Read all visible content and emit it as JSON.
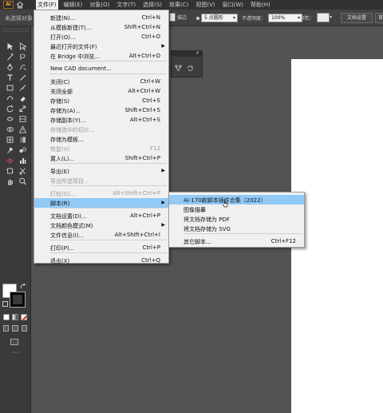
{
  "app": {
    "logo_text": "Ai"
  },
  "menubar": {
    "items": [
      "文件(F)",
      "编辑(E)",
      "对象(O)",
      "文字(T)",
      "选择(S)",
      "效果(C)",
      "视图(V)",
      "窗口(W)",
      "帮助(H)"
    ]
  },
  "controlbar": {
    "selection_status": "未选择对象",
    "style_label": "描边",
    "brush_value": "5 点圆形",
    "opacity_label": "不透明度：",
    "opacity_value": "100%",
    "opacity_arrow": ">",
    "styles_label": "样式：",
    "doc_setup_button": "文档设置",
    "prefs_button": "首"
  },
  "file_menu": {
    "items": [
      {
        "label": "新建(N)...",
        "shortcut": "Ctrl+N"
      },
      {
        "label": "从模板新建(T)...",
        "shortcut": "Shift+Ctrl+N"
      },
      {
        "label": "打开(O)...",
        "shortcut": "Ctrl+O"
      },
      {
        "label": "最近打开的文件(F)",
        "shortcut": "",
        "submenu": true
      },
      {
        "label": "在 Bridge 中浏览...",
        "shortcut": "Alt+Ctrl+O"
      },
      {
        "label": "New CAD document...",
        "shortcut": ""
      },
      {
        "label": "关闭(C)",
        "shortcut": "Ctrl+W"
      },
      {
        "label": "关闭全部",
        "shortcut": "Alt+Ctrl+W"
      },
      {
        "label": "存储(S)",
        "shortcut": "Ctrl+S"
      },
      {
        "label": "存储为(A)...",
        "shortcut": "Shift+Ctrl+S"
      },
      {
        "label": "存储副本(Y)...",
        "shortcut": "Alt+Ctrl+S"
      },
      {
        "label": "存储选中的切片...",
        "shortcut": "",
        "disabled": true
      },
      {
        "label": "存储为模板...",
        "shortcut": ""
      },
      {
        "label": "恢复(V)",
        "shortcut": "F12",
        "disabled": true
      },
      {
        "label": "置入(L)...",
        "shortcut": "Shift+Ctrl+P"
      },
      {
        "label": "导出(E)",
        "shortcut": "",
        "submenu": true
      },
      {
        "label": "导出所选项目...",
        "shortcut": "",
        "disabled": true
      },
      {
        "label": "打包(G)...",
        "shortcut": "Alt+Shift+Ctrl+P",
        "disabled": true
      },
      {
        "label": "脚本(R)",
        "shortcut": "",
        "submenu": true,
        "active": true
      },
      {
        "label": "文档设置(D)...",
        "shortcut": "Alt+Ctrl+P"
      },
      {
        "label": "文档颜色模式(M)",
        "shortcut": "",
        "submenu": true
      },
      {
        "label": "文件信息(I)...",
        "shortcut": "Alt+Shift+Ctrl+I"
      },
      {
        "label": "打印(P)...",
        "shortcut": "Ctrl+P"
      },
      {
        "label": "退出(X)",
        "shortcut": "Ctrl+Q"
      }
    ]
  },
  "scripts_submenu": {
    "items": [
      {
        "label": "AI-170款脚本插件合集（2022）",
        "shortcut": "",
        "active": true
      },
      {
        "label": "图像描摹",
        "shortcut": ""
      },
      {
        "label": "将文档存储为 PDF",
        "shortcut": ""
      },
      {
        "label": "将文档存储为 SVG",
        "shortcut": ""
      },
      {
        "label": "其它脚本...",
        "shortcut": "Ctrl+F12"
      }
    ]
  },
  "colors": {
    "menu_highlight": "#91c9f7",
    "app_bg": "#535353",
    "toolbar_bg": "#3a3a3a",
    "logo_orange": "#f7a732",
    "tool_pink": "#e0407a"
  },
  "toolbar": {
    "tools": [
      "selection-tool",
      "direct-selection-tool",
      "magic-wand-tool",
      "lasso-tool",
      "pen-tool",
      "curvature-tool",
      "type-tool",
      "line-segment-tool",
      "rectangle-tool",
      "paintbrush-tool",
      "shaper-tool",
      "eraser-tool",
      "rotate-tool",
      "scale-tool",
      "width-tool",
      "free-transform-tool",
      "shape-builder-tool",
      "perspective-grid-tool",
      "mesh-tool",
      "gradient-tool",
      "eyedropper-tool",
      "blend-tool",
      "symbol-sprayer-tool",
      "column-graph-tool",
      "artboard-tool",
      "slice-tool",
      "hand-tool",
      "zoom-tool"
    ],
    "more_tools": "···"
  }
}
